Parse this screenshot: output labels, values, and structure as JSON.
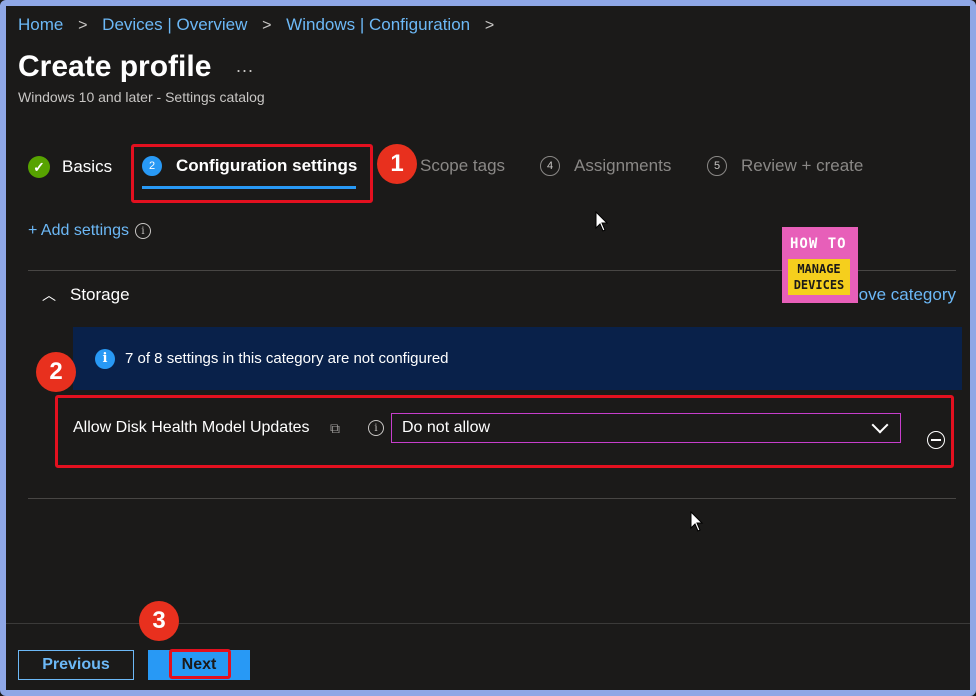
{
  "breadcrumb": {
    "items": [
      "Home",
      "Devices | Overview",
      "Windows | Configuration"
    ],
    "separator": ">"
  },
  "page": {
    "title": "Create profile",
    "more_label": "...",
    "subtitle": "Windows 10 and later - Settings catalog"
  },
  "steps": [
    {
      "label": "Basics",
      "state": "completed",
      "icon": "checkmark-icon"
    },
    {
      "label": "Configuration settings",
      "number": "2",
      "state": "active"
    },
    {
      "label": "Scope tags",
      "number": "3",
      "state": "pending"
    },
    {
      "label": "Assignments",
      "number": "4",
      "state": "pending"
    },
    {
      "label": "Review + create",
      "number": "5",
      "state": "pending"
    }
  ],
  "add_settings": {
    "label": "+ Add settings",
    "info": "i"
  },
  "category": {
    "name": "Storage",
    "remove_label": "Remove category",
    "banner_text": "7 of 8 settings in this category are not configured",
    "banner_icon": "i"
  },
  "setting": {
    "label": "Allow Disk Health Model Updates",
    "value": "Do not allow",
    "info": "i"
  },
  "logo": {
    "line1": "HOW TO",
    "line2": "MANAGE",
    "line3": "DEVICES"
  },
  "annotations": {
    "badge1": "1",
    "badge2": "2",
    "badge3": "3"
  },
  "footer": {
    "previous_label": "Previous",
    "next_label": "Next"
  },
  "colors": {
    "accent": "#2899f5",
    "link": "#6cb8f6",
    "highlight": "#e3101f",
    "success": "#57a300"
  }
}
